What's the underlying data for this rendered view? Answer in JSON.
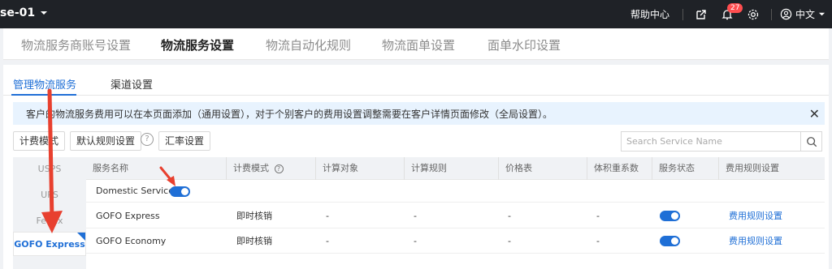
{
  "topbar": {
    "title": "se-01",
    "help_center": "帮助中心",
    "notification_count": "27",
    "language": "中文"
  },
  "tabs": [
    {
      "label": "物流服务商账号设置"
    },
    {
      "label": "物流服务设置"
    },
    {
      "label": "物流自动化规则"
    },
    {
      "label": "物流面单设置"
    },
    {
      "label": "面单水印设置"
    }
  ],
  "subtabs": [
    {
      "label": "管理物流服务"
    },
    {
      "label": "渠道设置"
    }
  ],
  "notice": {
    "text": "客户的物流服务费用可以在本页面添加（通用设置），对于个别客户的费用设置调整需要在客户详情页面修改（全局设置）。",
    "close": "✕"
  },
  "toolbar": {
    "billing_mode": "计费模式",
    "default_rule": "默认规则设置",
    "help": "?",
    "exchange_rate": "汇率设置",
    "search_placeholder": "Search Service Name"
  },
  "carriers": [
    {
      "label": "USPS"
    },
    {
      "label": "UPS"
    },
    {
      "label": "FedEx"
    },
    {
      "label": "GOFO Express"
    }
  ],
  "table": {
    "headers": {
      "service_name": "服务名称",
      "billing_mode": "计费模式",
      "billing_mode_help": "?",
      "billing_object": "计算对象",
      "billing_rule": "计算规则",
      "price_table": "价格表",
      "volume_factor": "体积重系数",
      "status": "服务状态",
      "fee_rule": "费用规则设置"
    },
    "group": {
      "label": "Domestic Service"
    },
    "rows": [
      {
        "service": "GOFO Express",
        "mode": "即时核销",
        "object": "-",
        "rule": "-",
        "price": "-",
        "volume": "-",
        "action": "费用规则设置"
      },
      {
        "service": "GOFO Economy",
        "mode": "即时核销",
        "object": "-",
        "rule": "-",
        "price": "-",
        "volume": "-",
        "action": "费用规则设置"
      }
    ]
  },
  "colors": {
    "primary": "#1f6fd6",
    "topbar": "#1f2227",
    "annotation": "#e8402f"
  }
}
